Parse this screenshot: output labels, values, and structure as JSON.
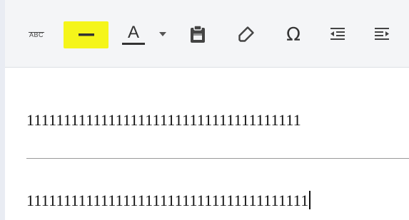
{
  "toolbar": {
    "strikethrough_label": "ABC",
    "text_color_letter": "A",
    "icons": [
      "strikethrough-icon",
      "horizontal-line-icon",
      "text-color-icon",
      "chevron-down-icon",
      "paste-icon",
      "eraser-icon",
      "omega-icon",
      "outdent-icon",
      "indent-icon"
    ],
    "highlight_color": "#f5f51a",
    "text_color_bar": "#333333"
  },
  "editor": {
    "lines": [
      "1111111111111111111111111111111111111",
      "11111111111111111111111111111111111111"
    ]
  }
}
